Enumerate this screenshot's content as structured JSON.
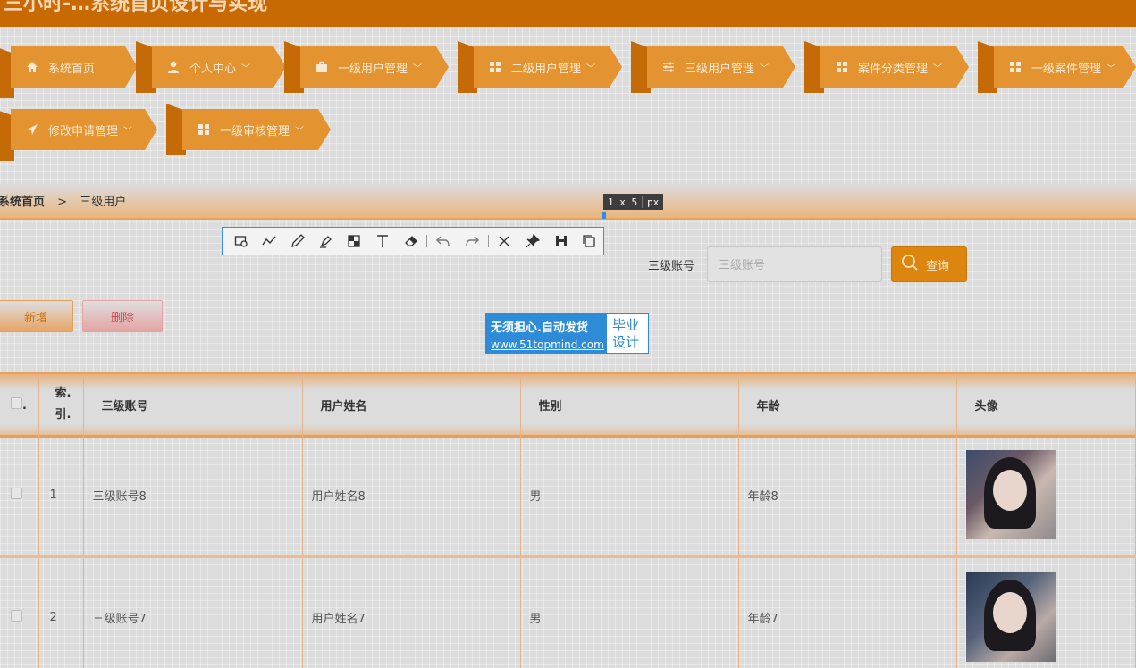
{
  "header": {
    "title": "三小时-…系统首页设计与实现"
  },
  "nav": [
    {
      "label": "系统首页",
      "icon": "home-icon",
      "has_caret": false
    },
    {
      "label": "个人中心",
      "icon": "user-icon",
      "has_caret": true
    },
    {
      "label": "一级用户管理",
      "icon": "briefcase-icon",
      "has_caret": true
    },
    {
      "label": "二级用户管理",
      "icon": "grid-icon",
      "has_caret": true
    },
    {
      "label": "三级用户管理",
      "icon": "sliders-icon",
      "has_caret": true
    },
    {
      "label": "案件分类管理",
      "icon": "grid-icon",
      "has_caret": true
    },
    {
      "label": "一级案件管理",
      "icon": "grid-icon",
      "has_caret": true
    },
    {
      "label": "修改申请管理",
      "icon": "send-icon",
      "has_caret": true
    },
    {
      "label": "一级审核管理",
      "icon": "grid-icon",
      "has_caret": true
    }
  ],
  "breadcrumb": {
    "home": "系统首页",
    "separator": ">",
    "current": "三级用户"
  },
  "capture_tool": {
    "size_text": "1 x 5",
    "unit": "px",
    "tools": [
      "rectangle-icon",
      "curve-icon",
      "pen-icon",
      "marker-icon",
      "mosaic-icon",
      "text-icon",
      "eraser-icon",
      "undo-icon",
      "redo-icon",
      "close-icon",
      "pin-icon",
      "save-icon",
      "copy-icon"
    ]
  },
  "search": {
    "label": "三级账号",
    "placeholder": "三级账号",
    "button_label": "查询"
  },
  "actions": {
    "add_label": "新增",
    "delete_label": "删除"
  },
  "watermark": {
    "line1": "无须担心.自动发货",
    "line2": "www.51topmind.com",
    "badge_line1": "毕业",
    "badge_line2": "设计"
  },
  "table": {
    "columns": [
      "索引",
      "三级账号",
      "用户姓名",
      "性别",
      "年龄",
      "头像"
    ],
    "index_header_line1": "索.",
    "index_header_line2": "引.",
    "checkbox_header_suffix": ".",
    "rows": [
      {
        "index": "1",
        "account": "三级账号8",
        "name": "用户姓名8",
        "sex": "男",
        "age": "年龄8"
      },
      {
        "index": "2",
        "account": "三级账号7",
        "name": "用户姓名7",
        "sex": "男",
        "age": "年龄7"
      }
    ]
  },
  "colors": {
    "accent": "#dc8610",
    "header": "#c86a04",
    "nav": "#e39431",
    "danger": "#cd4b4b"
  }
}
